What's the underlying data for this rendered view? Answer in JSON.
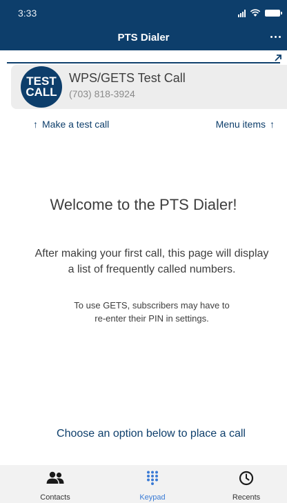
{
  "status_bar": {
    "time": "3:33"
  },
  "nav": {
    "title": "PTS Dialer"
  },
  "test_call": {
    "avatar_line1": "TEST",
    "avatar_line2": "CALL",
    "title": "WPS/GETS Test Call",
    "phone": "(703) 818-3924"
  },
  "hints": {
    "left": "Make a test call",
    "right": "Menu items"
  },
  "welcome": {
    "heading": "Welcome to the PTS Dialer!",
    "line1": "After making your first call, this page will display",
    "line2": "a list of frequently called numbers.",
    "gets_line1": "To use GETS, subscribers may have to",
    "gets_line2": "re-enter their PIN in settings."
  },
  "prompt": "Choose an option below to place a call",
  "tabs": [
    {
      "label": "Contacts",
      "icon": "contacts-icon",
      "active": false
    },
    {
      "label": "Keypad",
      "icon": "keypad-icon",
      "active": true
    },
    {
      "label": "Recents",
      "icon": "clock-icon",
      "active": false
    }
  ],
  "colors": {
    "primary": "#0d3e6b",
    "active_tab": "#3a7bd5",
    "card_bg": "#ededed"
  }
}
